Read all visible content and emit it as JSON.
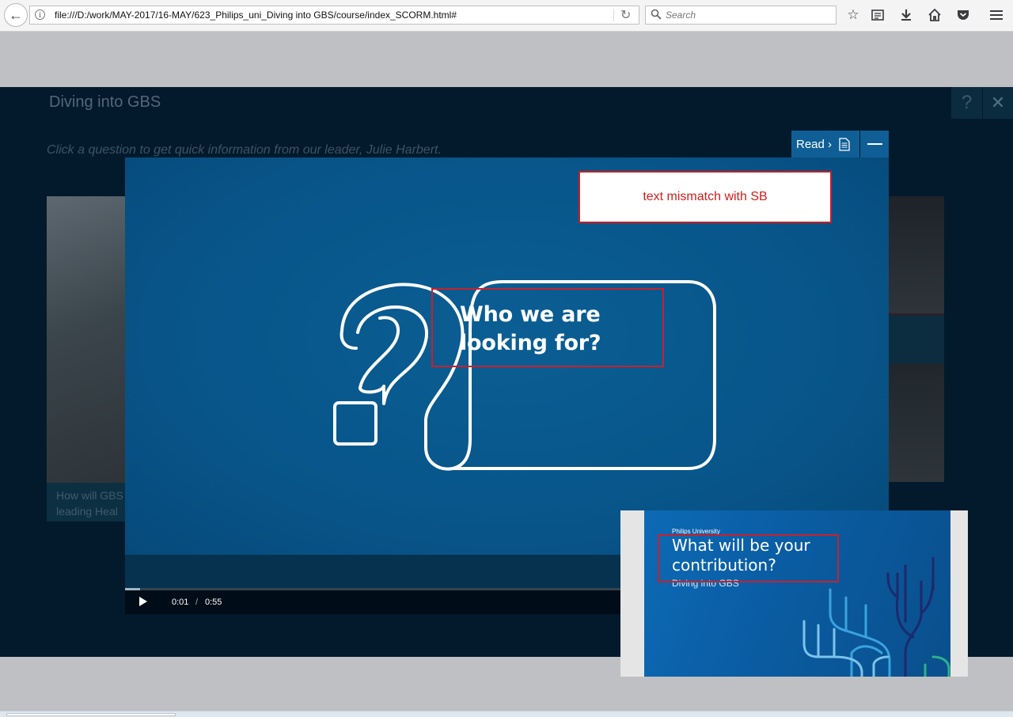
{
  "browser": {
    "url": "file:///D:/work/MAY-2017/16-MAY/623_Philips_uni_Diving into GBS/course/index_SCORM.html#",
    "search_placeholder": "Search",
    "info_glyph": "i",
    "icons": [
      "back-arrow-icon",
      "info-icon",
      "reload-icon",
      "search-icon",
      "bookmark-star-icon",
      "reading-list-icon",
      "download-icon",
      "home-icon",
      "pocket-icon",
      "menu-icon"
    ]
  },
  "course": {
    "title": "Diving into GBS",
    "instruction": "Click a question to get quick information from our leader, Julie Harbert.",
    "help_glyph": "?",
    "close_glyph": "✕",
    "left_card_caption": [
      "How will GBS",
      "leading Heal"
    ]
  },
  "video": {
    "read_label": "Read ›",
    "question_text": "Who we are looking for?",
    "current_time": "0:01",
    "time_separator": "/",
    "total_time": "0:55",
    "progress": 0.02
  },
  "review": {
    "note": "text mismatch with SB",
    "highlight_color": "#c6222b"
  },
  "thumbnail": {
    "brand": "Philips University",
    "title": "What will be your contribution?",
    "subtitle": "Diving into GBS"
  },
  "colors": {
    "course_bg": "#021a2c",
    "video_blue": "#08558a",
    "accent_blue": "#0f5f96"
  }
}
